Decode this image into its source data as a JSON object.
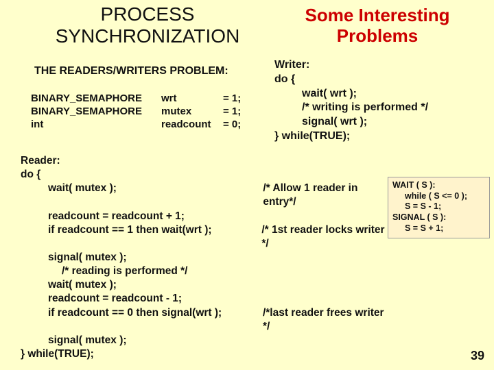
{
  "titles": {
    "left_line1": "PROCESS",
    "left_line2": "SYNCHRONIZATION",
    "right_line1": "Some Interesting",
    "right_line2": "Problems"
  },
  "subtitle": "THE READERS/WRITERS PROBLEM:",
  "decls": [
    {
      "type": "BINARY_SEMAPHORE",
      "var": "wrt",
      "val": "= 1;"
    },
    {
      "type": "BINARY_SEMAPHORE",
      "var": "mutex",
      "val": "= 1;"
    },
    {
      "type": "int",
      "var": "readcount",
      "val": "= 0;"
    }
  ],
  "writer": {
    "l1": "Writer:",
    "l2": "do {",
    "l3": "wait( wrt );",
    "l4": "/*   writing is performed   */",
    "l5": "signal( wrt );",
    "l6": "} while(TRUE);"
  },
  "reader": {
    "l1": "Reader:",
    "l2": "do {",
    "l3a": "wait( mutex );",
    "l3b": "/* Allow 1 reader in entry*/",
    "l4": "readcount = readcount + 1;",
    "l5a": "if readcount == 1  then  wait(wrt );",
    "l5b": "/* 1st reader locks writer */",
    "l6": "signal( mutex );",
    "l7": "/*   reading is performed   */",
    "l8": "wait( mutex );",
    "l9": "readcount = readcount - 1;",
    "l10a": "if readcount == 0  then  signal(wrt );",
    "l10b": "/*last reader frees writer */",
    "l11": "signal( mutex );",
    "l12": "} while(TRUE);"
  },
  "semabox": {
    "wait_hdr": "WAIT ( S ):",
    "wait_1": "while   ( S  <=  0 );",
    "wait_2": "S  =  S  -  1;",
    "sig_hdr": "SIGNAL ( S ):",
    "sig_1": "S  =  S  +  1;"
  },
  "pagenum": "39"
}
